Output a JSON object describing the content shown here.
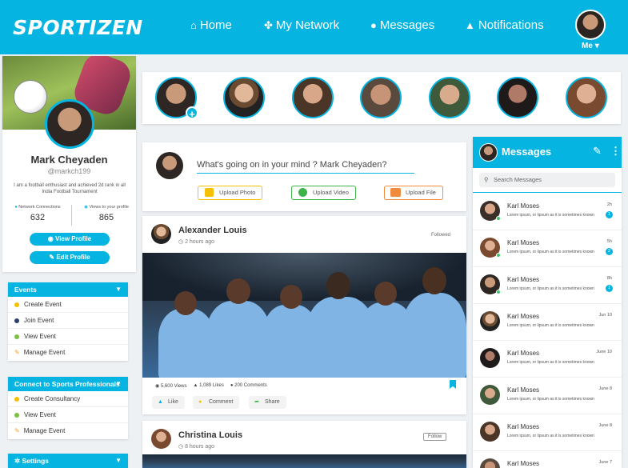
{
  "header": {
    "logo": "SPORTIZEN",
    "nav": [
      {
        "icon": "home-icon",
        "label": "Home"
      },
      {
        "icon": "network-icon",
        "label": "My Network"
      },
      {
        "icon": "message-icon",
        "label": "Messages"
      },
      {
        "icon": "bell-icon",
        "label": "Notifications"
      }
    ],
    "me_label": "Me"
  },
  "profile": {
    "name": "Mark Cheyaden",
    "handle": "@markch199",
    "bio": "I am a football enthusiast and achieved 2d rank in all India Football Tournament",
    "connections_label": "Network Connections",
    "connections": "632",
    "views_label": "Views to your profile",
    "views": "865",
    "view_profile": "View Profile",
    "edit_profile": "Edit Profile"
  },
  "menus": {
    "events": {
      "title": "Events",
      "items": [
        "Create Event",
        "Join Event",
        "View Event",
        "Manage Event"
      ]
    },
    "connect": {
      "title": "Connect to Sports Professionals",
      "items": [
        "Create Consultancy",
        "View Event",
        "Manage Event"
      ]
    },
    "settings": {
      "title": "Settings"
    }
  },
  "composer": {
    "prompt": "What's going on in your mind ? Mark Cheyaden?",
    "upload_photo": "Upload Photo",
    "upload_video": "Upload Video",
    "upload_file": "Upload File"
  },
  "posts": [
    {
      "name": "Alexander Louis",
      "time": "2 hours ago",
      "status": "Followed",
      "views": "5,600 Views",
      "likes": "1,089 Likes",
      "comments": "200 Comments",
      "like": "Like",
      "comment": "Comment",
      "share": "Share"
    },
    {
      "name": "Christina Louis",
      "time": "8 hours ago",
      "status": "Follow"
    }
  ],
  "messages": {
    "title": "Messages",
    "search_placeholder": "Search Messages",
    "items": [
      {
        "name": "Karl Moses",
        "text": "Lorem ipsum, or lipsum as it is sometimes known",
        "time": "2h",
        "badge": "1"
      },
      {
        "name": "Karl Moses",
        "text": "Lorem ipsum, or lipsum as it is sometimes known",
        "time": "5h",
        "badge": "2"
      },
      {
        "name": "Karl Moses",
        "text": "Lorem ipsum, or lipsum as it is sometimes known",
        "time": "8h",
        "badge": "1"
      },
      {
        "name": "Karl Moses",
        "text": "Lorem ipsum, or lipsum as it is sometimes known",
        "time": "Jun 10"
      },
      {
        "name": "Karl Moses",
        "text": "Lorem ipsum, or lipsum as it is sometimes known",
        "time": "June 10"
      },
      {
        "name": "Karl Moses",
        "text": "Lorem ipsum, or lipsum as it is sometimes known",
        "time": "June 8"
      },
      {
        "name": "Karl Moses",
        "text": "Lorem ipsum, or lipsum as it is sometimes known",
        "time": "June 8"
      },
      {
        "name": "Karl Moses",
        "text": "",
        "time": "June 7"
      }
    ]
  },
  "colors": {
    "accent": "#05b4e0",
    "background": "#eef1f4"
  }
}
